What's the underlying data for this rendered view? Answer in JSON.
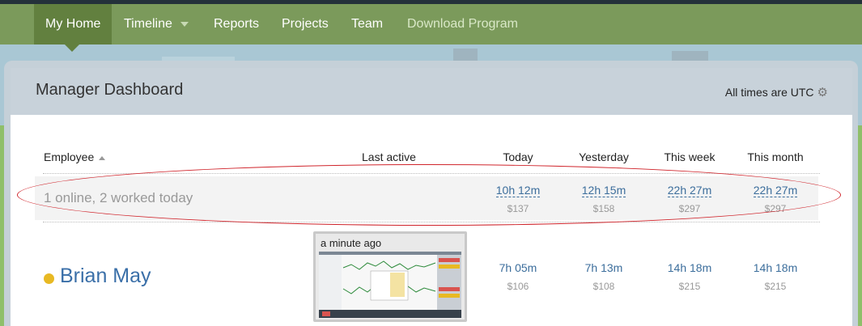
{
  "nav": {
    "items": [
      "My Home",
      "Timeline",
      "Reports",
      "Projects",
      "Team",
      "Download Program"
    ]
  },
  "panel": {
    "title": "Manager Dashboard",
    "utc_label": "All times are UTC"
  },
  "table": {
    "columns": [
      "Employee",
      "Last active",
      "Today",
      "Yesterday",
      "This week",
      "This month"
    ]
  },
  "summary": {
    "text": "1 online, 2 worked today",
    "times": [
      "10h 12m",
      "12h 15m",
      "22h 27m",
      "22h 27m"
    ],
    "amounts": [
      "$137",
      "$158",
      "$297",
      "$297"
    ]
  },
  "employees": [
    {
      "name": "Brian May",
      "last_active": "a minute ago",
      "status_color": "#e8b923",
      "times": [
        "7h 05m",
        "7h 13m",
        "14h 18m",
        "14h 18m"
      ],
      "amounts": [
        "$106",
        "$108",
        "$215",
        "$215"
      ]
    }
  ],
  "colors": {
    "nav_bg": "#7b9a5b",
    "nav_active": "#62803f",
    "link": "#3c6e9c",
    "highlight_oval": "#d0252c"
  }
}
